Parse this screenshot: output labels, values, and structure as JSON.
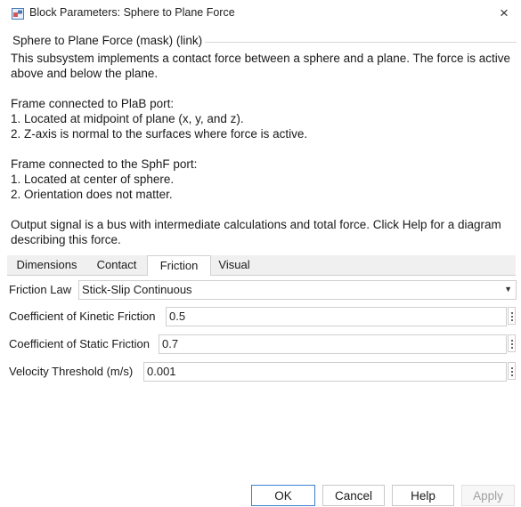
{
  "window": {
    "title": "Block Parameters: Sphere to Plane Force",
    "close_symbol": "×"
  },
  "group": {
    "title": "Sphere to Plane Force (mask) (link)"
  },
  "description": {
    "paragraphs": [
      "This subsystem implements a contact force between a sphere and a plane.  The force is active above and below the plane.",
      "Frame connected to PlaB port:\n1. Located at midpoint of plane (x, y, and z).\n2. Z-axis is normal to the surfaces where force is active.",
      "Frame connected to the SphF port:\n1. Located at center of sphere.\n2. Orientation does not matter.",
      "Output signal is a bus with intermediate calculations and total force. Click Help for a diagram describing this force."
    ]
  },
  "tabs": [
    {
      "label": "Dimensions",
      "active": false
    },
    {
      "label": "Contact",
      "active": false
    },
    {
      "label": "Friction",
      "active": true
    },
    {
      "label": "Visual",
      "active": false
    }
  ],
  "friction": {
    "law_label": "Friction Law",
    "law_value": "Stick-Slip Continuous",
    "kinetic_label": "Coefficient of Kinetic Friction",
    "kinetic_value": "0.5",
    "static_label": "Coefficient of Static Friction",
    "static_value": "0.7",
    "velocity_label": "Velocity Threshold (m/s)",
    "velocity_value": "0.001"
  },
  "buttons": {
    "ok": "OK",
    "cancel": "Cancel",
    "help": "Help",
    "apply": "Apply"
  },
  "icons": {
    "app": "simulink-block-icon",
    "close": "close-icon",
    "dropdown": "chevron-down-icon",
    "more": "kebab-menu-icon"
  }
}
